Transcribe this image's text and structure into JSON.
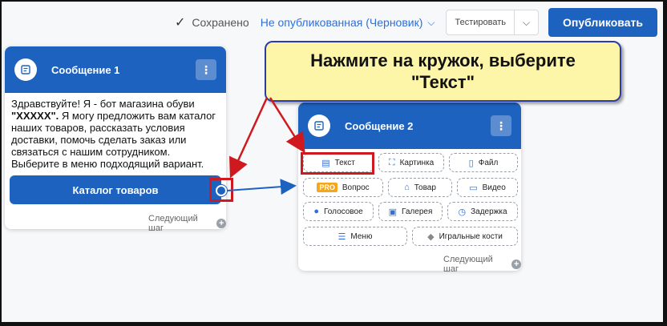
{
  "topbar": {
    "saved_label": "Сохранено",
    "status_label": "Не опубликованная (Черновик)",
    "test_label": "Тестировать",
    "publish_label": "Опубликовать"
  },
  "card1": {
    "title": "Сообщение 1",
    "text_pre": "Здравствуйте! Я - бот магазина обуви ",
    "text_bold": "\"ХХХХХ\".",
    "text_post": " Я могу предложить вам каталог наших товаров, рассказать условия доставки, помочь сделать заказ или связаться с нашим сотрудником. Выберите в меню подходящий вариант.",
    "button_label": "Каталог товаров",
    "next_label": "Следующий шаг"
  },
  "card2": {
    "title": "Сообщение 2",
    "options": {
      "text": "Текст",
      "image": "Картинка",
      "file": "Файл",
      "pro_badge": "PRO",
      "question": "Вопрос",
      "product": "Товар",
      "video": "Видео",
      "voice": "Голосовое",
      "gallery": "Галерея",
      "delay": "Задержка",
      "menu": "Меню",
      "dice": "Игральные кости"
    },
    "next_label": "Следующий шаг"
  },
  "callout": {
    "line1": "Нажмите на кружок, выберите",
    "line2": "\"Текст\""
  },
  "colors": {
    "brand": "#1e62c0",
    "highlight": "#d0191f",
    "callout_bg": "#fdf6a8",
    "pro": "#f4a61c"
  }
}
